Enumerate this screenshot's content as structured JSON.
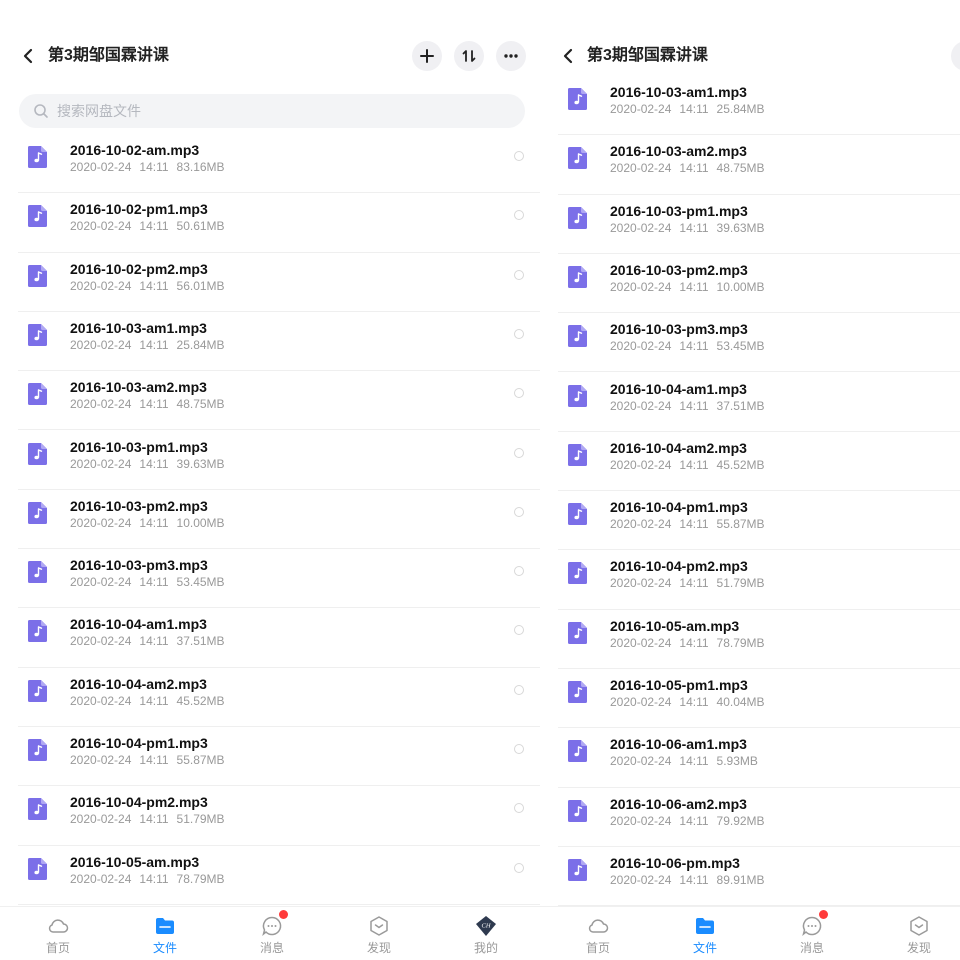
{
  "header": {
    "title": "第3期邹国霖讲课"
  },
  "search": {
    "placeholder": "搜索网盘文件"
  },
  "colors": {
    "accent": "#1a8cff",
    "audio_icon": "#7b6fe8",
    "badge": "#ff3b3b"
  },
  "left_files": [
    {
      "name": "2016-10-02-am.mp3",
      "date": "2020-02-24",
      "time": "14:11",
      "size": "83.16MB"
    },
    {
      "name": "2016-10-02-pm1.mp3",
      "date": "2020-02-24",
      "time": "14:11",
      "size": "50.61MB"
    },
    {
      "name": "2016-10-02-pm2.mp3",
      "date": "2020-02-24",
      "time": "14:11",
      "size": "56.01MB"
    },
    {
      "name": "2016-10-03-am1.mp3",
      "date": "2020-02-24",
      "time": "14:11",
      "size": "25.84MB"
    },
    {
      "name": "2016-10-03-am2.mp3",
      "date": "2020-02-24",
      "time": "14:11",
      "size": "48.75MB"
    },
    {
      "name": "2016-10-03-pm1.mp3",
      "date": "2020-02-24",
      "time": "14:11",
      "size": "39.63MB"
    },
    {
      "name": "2016-10-03-pm2.mp3",
      "date": "2020-02-24",
      "time": "14:11",
      "size": "10.00MB"
    },
    {
      "name": "2016-10-03-pm3.mp3",
      "date": "2020-02-24",
      "time": "14:11",
      "size": "53.45MB"
    },
    {
      "name": "2016-10-04-am1.mp3",
      "date": "2020-02-24",
      "time": "14:11",
      "size": "37.51MB"
    },
    {
      "name": "2016-10-04-am2.mp3",
      "date": "2020-02-24",
      "time": "14:11",
      "size": "45.52MB"
    },
    {
      "name": "2016-10-04-pm1.mp3",
      "date": "2020-02-24",
      "time": "14:11",
      "size": "55.87MB"
    },
    {
      "name": "2016-10-04-pm2.mp3",
      "date": "2020-02-24",
      "time": "14:11",
      "size": "51.79MB"
    },
    {
      "name": "2016-10-05-am.mp3",
      "date": "2020-02-24",
      "time": "14:11",
      "size": "78.79MB"
    }
  ],
  "right_files": [
    {
      "name": "2016-10-03-am1.mp3",
      "date": "2020-02-24",
      "time": "14:11",
      "size": "25.84MB"
    },
    {
      "name": "2016-10-03-am2.mp3",
      "date": "2020-02-24",
      "time": "14:11",
      "size": "48.75MB"
    },
    {
      "name": "2016-10-03-pm1.mp3",
      "date": "2020-02-24",
      "time": "14:11",
      "size": "39.63MB"
    },
    {
      "name": "2016-10-03-pm2.mp3",
      "date": "2020-02-24",
      "time": "14:11",
      "size": "10.00MB"
    },
    {
      "name": "2016-10-03-pm3.mp3",
      "date": "2020-02-24",
      "time": "14:11",
      "size": "53.45MB"
    },
    {
      "name": "2016-10-04-am1.mp3",
      "date": "2020-02-24",
      "time": "14:11",
      "size": "37.51MB"
    },
    {
      "name": "2016-10-04-am2.mp3",
      "date": "2020-02-24",
      "time": "14:11",
      "size": "45.52MB"
    },
    {
      "name": "2016-10-04-pm1.mp3",
      "date": "2020-02-24",
      "time": "14:11",
      "size": "55.87MB"
    },
    {
      "name": "2016-10-04-pm2.mp3",
      "date": "2020-02-24",
      "time": "14:11",
      "size": "51.79MB"
    },
    {
      "name": "2016-10-05-am.mp3",
      "date": "2020-02-24",
      "time": "14:11",
      "size": "78.79MB"
    },
    {
      "name": "2016-10-05-pm1.mp3",
      "date": "2020-02-24",
      "time": "14:11",
      "size": "40.04MB"
    },
    {
      "name": "2016-10-06-am1.mp3",
      "date": "2020-02-24",
      "time": "14:11",
      "size": "5.93MB"
    },
    {
      "name": "2016-10-06-am2.mp3",
      "date": "2020-02-24",
      "time": "14:11",
      "size": "79.92MB"
    },
    {
      "name": "2016-10-06-pm.mp3",
      "date": "2020-02-24",
      "time": "14:11",
      "size": "89.91MB"
    }
  ],
  "tabs": [
    {
      "label": "首页",
      "icon": "cloud-icon"
    },
    {
      "label": "文件",
      "icon": "folder-icon",
      "active": true
    },
    {
      "label": "消息",
      "icon": "chat-icon",
      "badge": true
    },
    {
      "label": "发现",
      "icon": "discover-icon"
    },
    {
      "label": "我的",
      "icon": "avatar-icon",
      "avatar_text": "CH"
    }
  ]
}
